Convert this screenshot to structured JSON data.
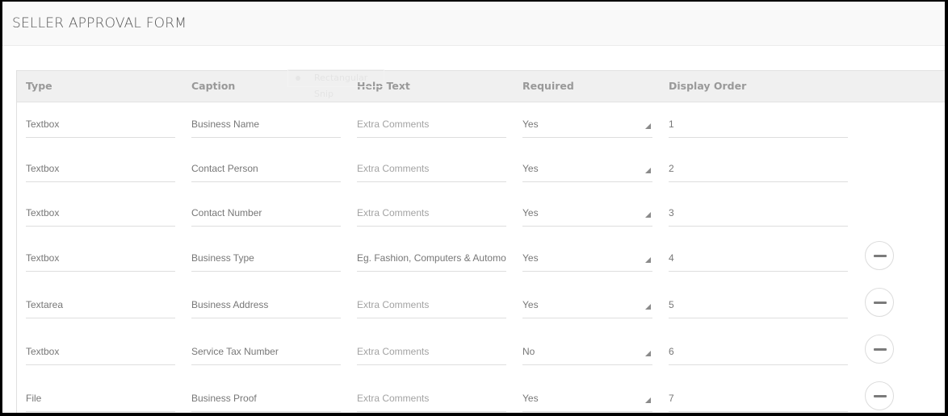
{
  "page": {
    "title": "SELLER APPROVAL FORM"
  },
  "overlay": {
    "ghost_text": "Rectangular Snip"
  },
  "table": {
    "headers": [
      "Type",
      "Caption",
      "Help Text",
      "Required",
      "Display Order"
    ],
    "rows": [
      {
        "type": "Textbox",
        "caption": "Business Name",
        "help_text": "",
        "help_placeholder": "Extra Comments",
        "required": "Yes",
        "order": "1",
        "removable": false
      },
      {
        "type": "Textbox",
        "caption": "Contact Person",
        "help_text": "",
        "help_placeholder": "Extra Comments",
        "required": "Yes",
        "order": "2",
        "removable": false
      },
      {
        "type": "Textbox",
        "caption": "Contact Number",
        "help_text": "",
        "help_placeholder": "Extra Comments",
        "required": "Yes",
        "order": "3",
        "removable": false
      },
      {
        "type": "Textbox",
        "caption": "Business Type",
        "help_text": "Eg. Fashion, Computers & Automo",
        "help_placeholder": "Extra Comments",
        "required": "Yes",
        "order": "4",
        "removable": true
      },
      {
        "type": "Textarea",
        "caption": "Business Address",
        "help_text": "",
        "help_placeholder": "Extra Comments",
        "required": "Yes",
        "order": "5",
        "removable": true
      },
      {
        "type": "Textbox",
        "caption": "Service Tax Number",
        "help_text": "",
        "help_placeholder": "Extra Comments",
        "required": "No",
        "order": "6",
        "removable": true
      },
      {
        "type": "File",
        "caption": "Business Proof",
        "help_text": "",
        "help_placeholder": "Extra Comments",
        "required": "Yes",
        "order": "7",
        "removable": true
      }
    ],
    "remove_icon": "minus-circle-icon"
  }
}
